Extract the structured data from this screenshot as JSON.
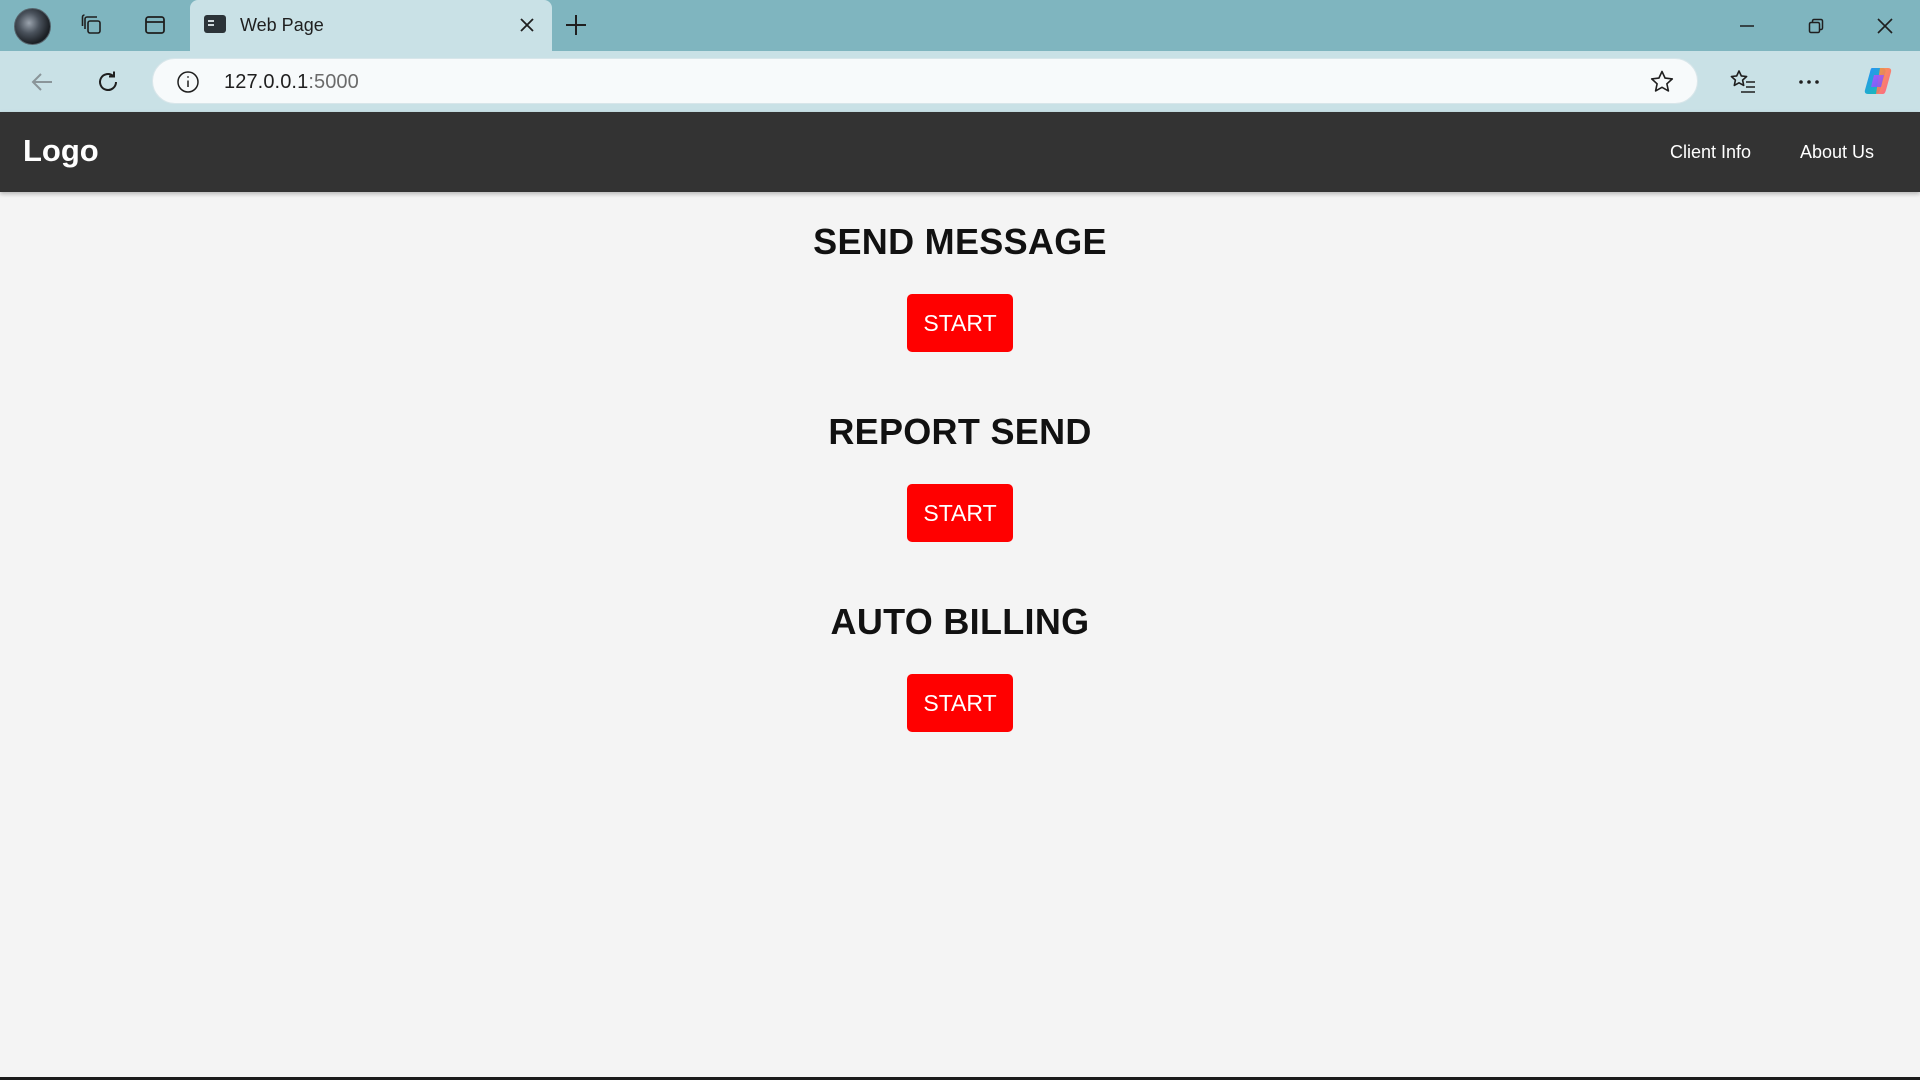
{
  "browser": {
    "tab_title": "Web Page",
    "url_host": "127.0.0.1",
    "url_port": ":5000"
  },
  "navbar": {
    "logo": "Logo",
    "links": [
      "Client Info",
      "About Us"
    ]
  },
  "sections": [
    {
      "title": "SEND MESSAGE",
      "button": "START"
    },
    {
      "title": "REPORT SEND",
      "button": "START"
    },
    {
      "title": "AUTO BILLING",
      "button": "START"
    }
  ],
  "colors": {
    "navbar_bg": "#333333",
    "button_bg": "#ff0000",
    "page_bg": "#f4f4f4"
  }
}
